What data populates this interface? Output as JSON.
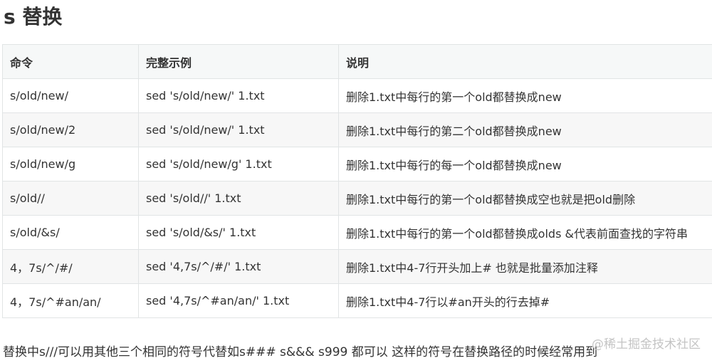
{
  "heading": "s 替换",
  "table": {
    "headers": [
      "命令",
      "完整示例",
      "说明"
    ],
    "rows": [
      [
        "s/old/new/",
        "sed 's/old/new/' 1.txt",
        "删除1.txt中每行的第一个old都替换成new"
      ],
      [
        "s/old/new/2",
        "sed 's/old/new/' 1.txt",
        "删除1.txt中每行的第二个old都替换成new"
      ],
      [
        "s/old/new/g",
        "sed 's/old/new/g' 1.txt",
        "删除1.txt中每行的每一个old都替换成new"
      ],
      [
        "s/old//",
        "sed 's/old//' 1.txt",
        "删除1.txt中每行的第一个old都替换成空也就是把old删除"
      ],
      [
        "s/old/&s/",
        "sed 's/old/&s/' 1.txt",
        "删除1.txt中每行的第一个old都替换成olds &代表前面查找的字符串"
      ],
      [
        "4，7s/^/#/",
        "sed '4,7s/^/#/' 1.txt",
        "删除1.txt中4-7行开头加上# 也就是批量添加注释"
      ],
      [
        "4，7s/^#an/an/",
        "sed '4,7s/^#an/an/' 1.txt",
        "删除1.txt中4-7行以#an开头的行去掉#"
      ]
    ]
  },
  "paragraph": "替换中s///可以用其他三个相同的符号代替如s### s&&& s999 都可以 这样的符号在替换路径的时候经常用到",
  "watermark": "@稀土掘金技术社区"
}
